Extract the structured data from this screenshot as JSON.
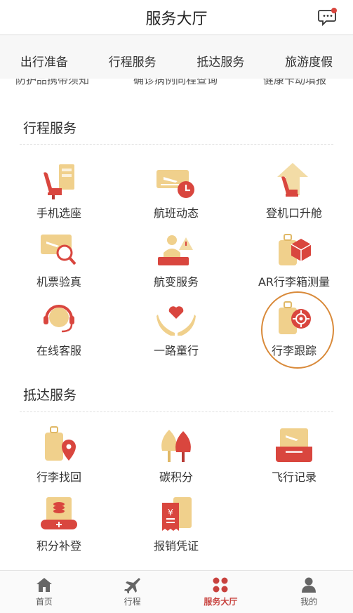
{
  "header": {
    "title": "服务大厅",
    "message_icon": "chat-bubble-icon"
  },
  "tabs": [
    {
      "label": "出行准备"
    },
    {
      "label": "行程服务",
      "active": true
    },
    {
      "label": "抵达服务"
    },
    {
      "label": "旅游度假"
    }
  ],
  "peek_labels": [
    "防护品携带须知",
    "确诊病例同程查询",
    "健康卡动填报"
  ],
  "sections": {
    "trip": {
      "title": "行程服务",
      "items": [
        {
          "label": "手机选座",
          "icon": "seat-select-icon"
        },
        {
          "label": "航班动态",
          "icon": "flight-status-icon"
        },
        {
          "label": "登机口升舱",
          "icon": "upgrade-seat-icon"
        },
        {
          "label": "机票验真",
          "icon": "ticket-verify-icon"
        },
        {
          "label": "航变服务",
          "icon": "flight-change-icon"
        },
        {
          "label": "AR行李箱测量",
          "icon": "ar-luggage-icon"
        },
        {
          "label": "在线客服",
          "icon": "customer-service-icon"
        },
        {
          "label": "一路童行",
          "icon": "child-travel-icon"
        },
        {
          "label": "行李跟踪",
          "icon": "luggage-track-icon"
        }
      ]
    },
    "arrival": {
      "title": "抵达服务",
      "items": [
        {
          "label": "行李找回",
          "icon": "luggage-find-icon"
        },
        {
          "label": "碳积分",
          "icon": "carbon-points-icon"
        },
        {
          "label": "飞行记录",
          "icon": "flight-record-icon"
        },
        {
          "label": "积分补登",
          "icon": "points-claim-icon"
        },
        {
          "label": "报销凭证",
          "icon": "receipt-icon"
        }
      ]
    }
  },
  "bottom_nav": [
    {
      "label": "首页",
      "icon": "home-icon"
    },
    {
      "label": "行程",
      "icon": "plane-icon"
    },
    {
      "label": "服务大厅",
      "icon": "grid-icon",
      "active": true
    },
    {
      "label": "我的",
      "icon": "user-icon"
    }
  ],
  "colors": {
    "accent": "#c8423e",
    "gold": "#e9c27a",
    "highlight_ring": "#d98a3a"
  }
}
